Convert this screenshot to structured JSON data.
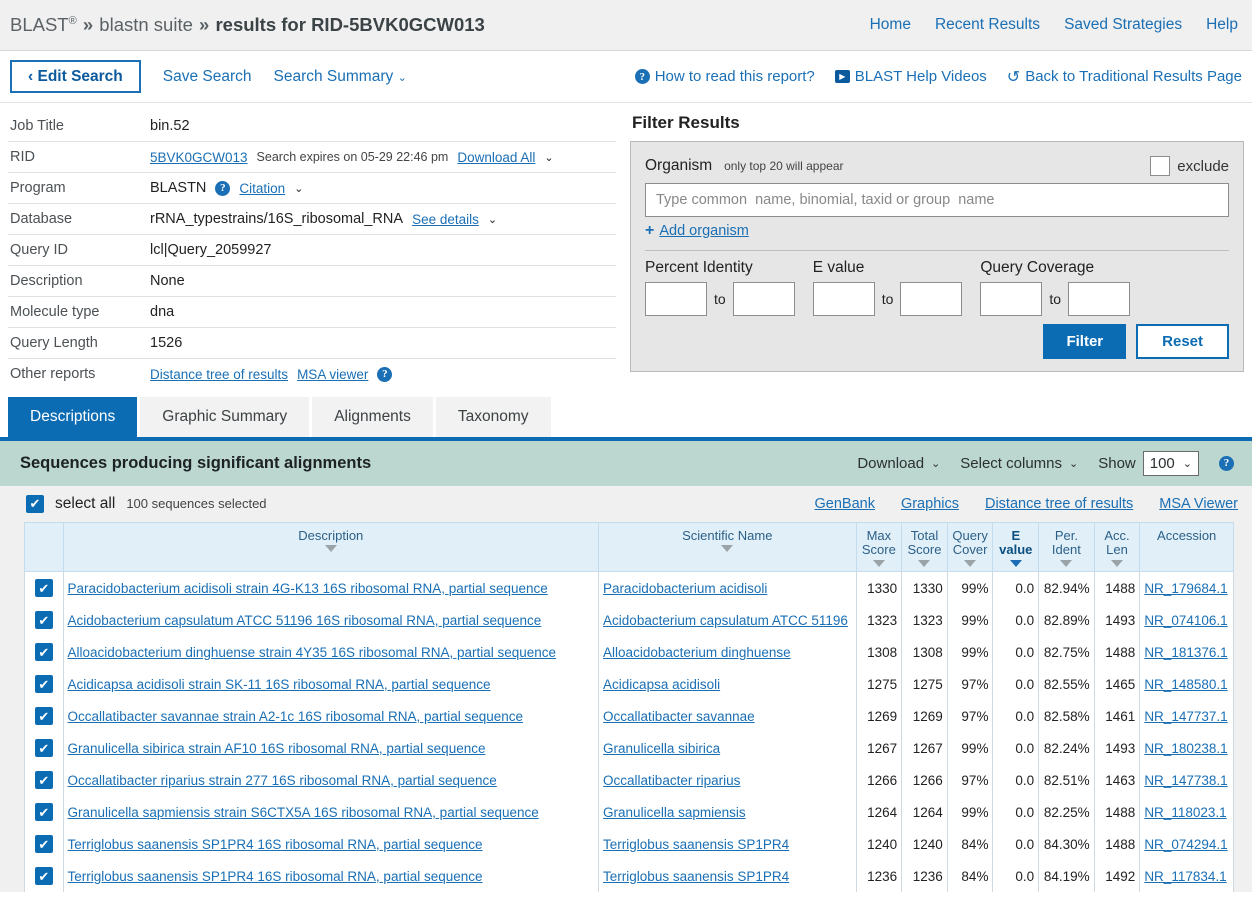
{
  "breadcrumb": {
    "brand": "BLAST",
    "reg": "®",
    "sep": "»",
    "suite": "blastn suite",
    "current": "results for RID-5BVK0GCW013"
  },
  "topnav": [
    {
      "label": "Home"
    },
    {
      "label": "Recent Results"
    },
    {
      "label": "Saved Strategies"
    },
    {
      "label": "Help"
    }
  ],
  "actionbar": {
    "edit_search": "Edit Search",
    "edit_search_caret": "‹",
    "save_search": "Save Search",
    "search_summary": "Search Summary",
    "caret": "⌄",
    "how_to_read": "How to read this report?",
    "help_videos": "BLAST Help Videos",
    "back_traditional": "Back to Traditional Results Page",
    "qmark": "?",
    "play": "▶",
    "reload": "↺"
  },
  "info": {
    "rows": [
      {
        "label": "Job Title",
        "value": "bin.52"
      },
      {
        "label": "RID",
        "value": "5BVK0GCW013",
        "note": "Search expires on 05-29 22:46 pm",
        "link2": "Download All"
      },
      {
        "label": "Program",
        "value": "BLASTN",
        "link2": "Citation"
      },
      {
        "label": "Database",
        "value": "rRNA_typestrains/16S_ribosomal_RNA",
        "link2": "See details"
      },
      {
        "label": "Query ID",
        "value": "lcl|Query_2059927"
      },
      {
        "label": "Description",
        "value": "None"
      },
      {
        "label": "Molecule type",
        "value": "dna"
      },
      {
        "label": "Query Length",
        "value": "1526"
      },
      {
        "label": "Other reports",
        "link_a": "Distance tree of results",
        "link_b": "MSA viewer"
      }
    ]
  },
  "filter": {
    "title": "Filter Results",
    "organism_label": "Organism",
    "organism_hint": "only top 20 will appear",
    "exclude_label": "exclude",
    "organism_placeholder": "Type common  name, binomial, taxid or group  name",
    "organism_value": "",
    "add_organism": "Add organism",
    "plus": "+",
    "percent_identity_label": "Percent Identity",
    "evalue_label": "E value",
    "query_coverage_label": "Query Coverage",
    "to": "to",
    "pi_from": "",
    "pi_to": "",
    "ev_from": "",
    "ev_to": "",
    "qc_from": "",
    "qc_to": "",
    "filter_btn": "Filter",
    "reset_btn": "Reset"
  },
  "tabs": [
    {
      "label": "Descriptions",
      "active": true
    },
    {
      "label": "Graphic Summary",
      "active": false
    },
    {
      "label": "Alignments",
      "active": false
    },
    {
      "label": "Taxonomy",
      "active": false
    }
  ],
  "results_header": {
    "title": "Sequences producing significant alignments",
    "download": "Download",
    "select_columns": "Select columns",
    "show": "Show",
    "show_value": "100",
    "caret": "⌄",
    "qmark": "?"
  },
  "select_row": {
    "select_all": "select all",
    "count_text": "100 sequences selected",
    "check": "✔",
    "links": [
      {
        "label": "GenBank"
      },
      {
        "label": "Graphics"
      },
      {
        "label": "Distance tree of results"
      },
      {
        "label": "MSA Viewer"
      }
    ]
  },
  "table": {
    "columns": [
      {
        "line1": "Description",
        "line2": "",
        "sorted": false
      },
      {
        "line1": "Scientific Name",
        "line2": "",
        "sorted": false
      },
      {
        "line1": "Max",
        "line2": "Score",
        "sorted": false
      },
      {
        "line1": "Total",
        "line2": "Score",
        "sorted": false
      },
      {
        "line1": "Query",
        "line2": "Cover",
        "sorted": false
      },
      {
        "line1": "E",
        "line2": "value",
        "sorted": true
      },
      {
        "line1": "Per.",
        "line2": "Ident",
        "sorted": false
      },
      {
        "line1": "Acc.",
        "line2": "Len",
        "sorted": false
      },
      {
        "line1": "Accession",
        "line2": "",
        "sorted": false
      }
    ],
    "rows": [
      {
        "description": "Paracidobacterium acidisoli strain 4G-K13 16S ribosomal RNA, partial sequence",
        "scientific_name": "Paracidobacterium acidisoli",
        "max_score": "1330",
        "total_score": "1330",
        "query_cover": "99%",
        "e_value": "0.0",
        "per_ident": "82.94%",
        "acc_len": "1488",
        "accession": "NR_179684.1"
      },
      {
        "description": "Acidobacterium capsulatum ATCC 51196 16S ribosomal RNA, partial sequence",
        "scientific_name": "Acidobacterium capsulatum ATCC 51196",
        "max_score": "1323",
        "total_score": "1323",
        "query_cover": "99%",
        "e_value": "0.0",
        "per_ident": "82.89%",
        "acc_len": "1493",
        "accession": "NR_074106.1"
      },
      {
        "description": "Alloacidobacterium dinghuense strain 4Y35 16S ribosomal RNA, partial sequence",
        "scientific_name": "Alloacidobacterium dinghuense",
        "max_score": "1308",
        "total_score": "1308",
        "query_cover": "99%",
        "e_value": "0.0",
        "per_ident": "82.75%",
        "acc_len": "1488",
        "accession": "NR_181376.1"
      },
      {
        "description": "Acidicapsa acidisoli strain SK-11 16S ribosomal RNA, partial sequence",
        "scientific_name": "Acidicapsa acidisoli",
        "max_score": "1275",
        "total_score": "1275",
        "query_cover": "97%",
        "e_value": "0.0",
        "per_ident": "82.55%",
        "acc_len": "1465",
        "accession": "NR_148580.1"
      },
      {
        "description": "Occallatibacter savannae strain A2-1c 16S ribosomal RNA, partial sequence",
        "scientific_name": "Occallatibacter savannae",
        "max_score": "1269",
        "total_score": "1269",
        "query_cover": "97%",
        "e_value": "0.0",
        "per_ident": "82.58%",
        "acc_len": "1461",
        "accession": "NR_147737.1"
      },
      {
        "description": "Granulicella sibirica strain AF10 16S ribosomal RNA, partial sequence",
        "scientific_name": "Granulicella sibirica",
        "max_score": "1267",
        "total_score": "1267",
        "query_cover": "99%",
        "e_value": "0.0",
        "per_ident": "82.24%",
        "acc_len": "1493",
        "accession": "NR_180238.1"
      },
      {
        "description": "Occallatibacter riparius strain 277 16S ribosomal RNA, partial sequence",
        "scientific_name": "Occallatibacter riparius",
        "max_score": "1266",
        "total_score": "1266",
        "query_cover": "97%",
        "e_value": "0.0",
        "per_ident": "82.51%",
        "acc_len": "1463",
        "accession": "NR_147738.1"
      },
      {
        "description": "Granulicella sapmiensis strain S6CTX5A 16S ribosomal RNA, partial sequence",
        "scientific_name": "Granulicella sapmiensis",
        "max_score": "1264",
        "total_score": "1264",
        "query_cover": "99%",
        "e_value": "0.0",
        "per_ident": "82.25%",
        "acc_len": "1488",
        "accession": "NR_118023.1"
      },
      {
        "description": "Terriglobus saanensis SP1PR4 16S ribosomal RNA, partial sequence",
        "scientific_name": "Terriglobus saanensis SP1PR4",
        "max_score": "1240",
        "total_score": "1240",
        "query_cover": "84%",
        "e_value": "0.0",
        "per_ident": "84.30%",
        "acc_len": "1488",
        "accession": "NR_074294.1"
      },
      {
        "description": "Terriglobus saanensis SP1PR4 16S ribosomal RNA, partial sequence",
        "scientific_name": "Terriglobus saanensis SP1PR4",
        "max_score": "1236",
        "total_score": "1236",
        "query_cover": "84%",
        "e_value": "0.0",
        "per_ident": "84.19%",
        "acc_len": "1492",
        "accession": "NR_117834.1"
      }
    ]
  },
  "colors": {
    "accent_blue": "#0c6cb3",
    "link_blue": "#1a6fb5",
    "results_band": "#bcd6d0",
    "table_header": "#e1f0f8",
    "panel_gray": "#e6e6e6"
  }
}
